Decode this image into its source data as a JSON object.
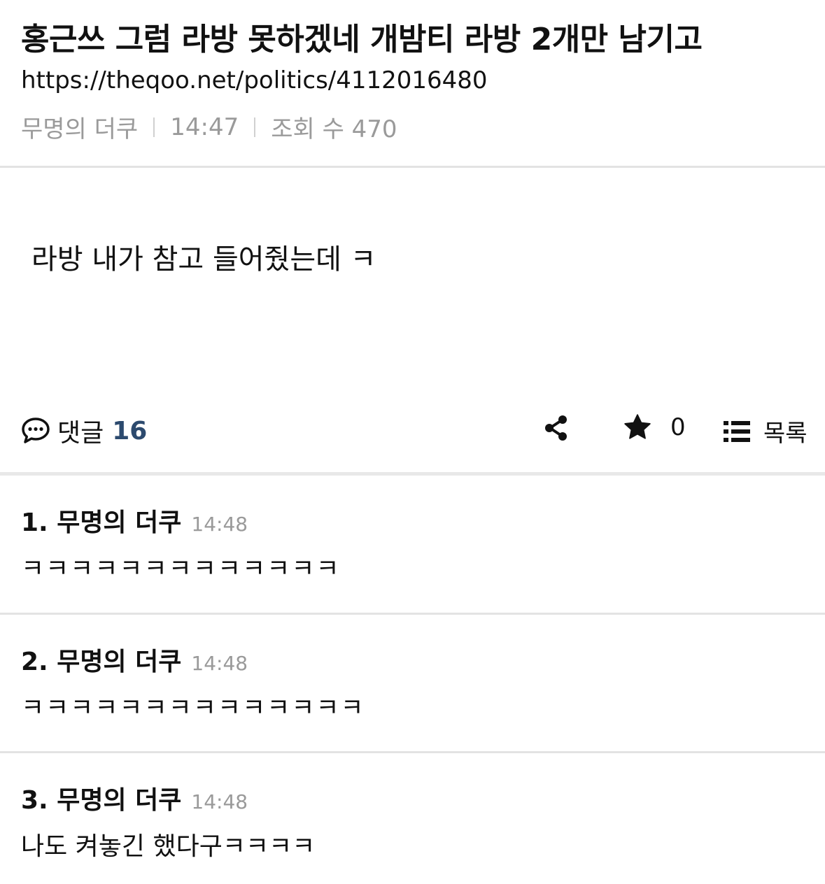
{
  "post": {
    "title": "홍근쓰 그럼 라방 못하겠네 개밤티 라방 2개만 남기고",
    "url": "https://theqoo.net/politics/4112016480",
    "author": "무명의 더쿠",
    "time": "14:47",
    "views_label": "조회 수 470",
    "body": "라방 내가 참고 들어줬는데 ㅋ"
  },
  "actions": {
    "comments_label": "댓글",
    "comments_count": "16",
    "star_count": "0",
    "list_label": "목록"
  },
  "comments": [
    {
      "number_author": "1. 무명의 더쿠",
      "time": "14:48",
      "text": "ㅋㅋㅋㅋㅋㅋㅋㅋㅋㅋㅋㅋㅋ"
    },
    {
      "number_author": "2. 무명의 더쿠",
      "time": "14:48",
      "text": "ㅋㅋㅋㅋㅋㅋㅋㅋㅋㅋㅋㅋㅋㅋ"
    },
    {
      "number_author": "3. 무명의 더쿠",
      "time": "14:48",
      "text": "나도 켜놓긴 했다구ㅋㅋㅋㅋ"
    }
  ],
  "icons": {
    "comment": "speech-bubble-icon",
    "share": "share-icon",
    "star": "star-icon",
    "list": "list-icon"
  }
}
